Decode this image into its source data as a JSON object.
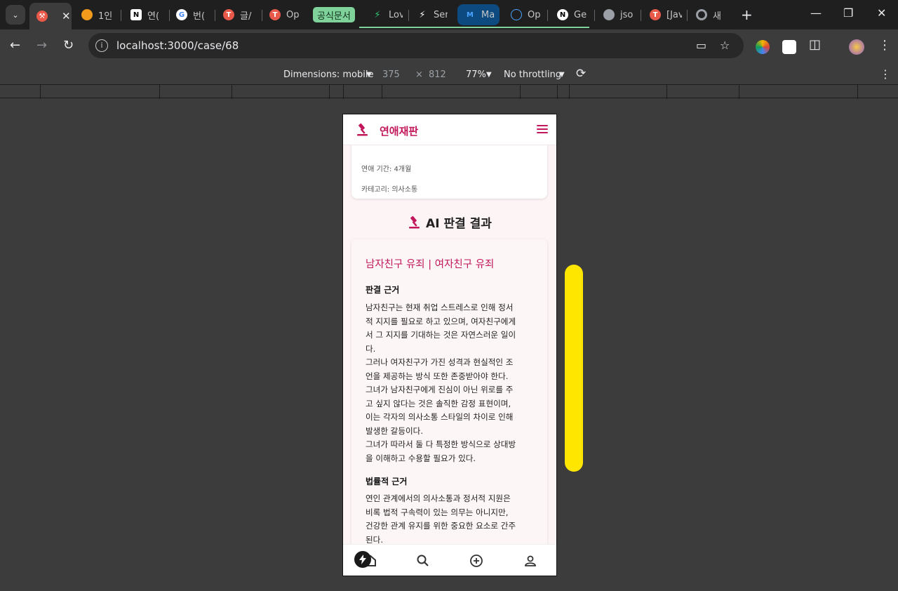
{
  "browser": {
    "tabs": [
      {
        "label": "",
        "icon": "gavel-icon",
        "color": "#e8594a"
      },
      {
        "label": "1인",
        "icon": "fire-icon",
        "color": "#f29a1c"
      },
      {
        "label": "연(",
        "icon": "notion-icon",
        "color": "#ffffff"
      },
      {
        "label": "번(",
        "icon": "google-icon",
        "color": "#4285f4"
      },
      {
        "label": "글/",
        "icon": "app-icon",
        "color": "#e8594a"
      },
      {
        "label": "Op",
        "icon": "app-icon",
        "color": "#e8594a"
      },
      {
        "label": "Lov",
        "icon": "bolt-icon",
        "color": "#2ecc71"
      },
      {
        "label": "Ser",
        "icon": "bolt-icon",
        "color": "#ffffff"
      },
      {
        "label": "Ma",
        "icon": "mj-icon",
        "color": "#4aa3ff"
      },
      {
        "label": "Op",
        "icon": "openai-icon",
        "color": "#4aa3ff"
      },
      {
        "label": "Ge",
        "icon": "n-icon",
        "color": "#ffffff"
      },
      {
        "label": "jso",
        "icon": "globe-icon",
        "color": "#9aa0a6"
      },
      {
        "label": "[Jav",
        "icon": "app-icon",
        "color": "#e8594a"
      },
      {
        "label": "새",
        "icon": "chrome-icon",
        "color": "#9aa0a6"
      }
    ],
    "special_tab": "공식문서",
    "url": "localhost:3000/case/68"
  },
  "devtools": {
    "dimensions": "Dimensions: mobile",
    "width": "375",
    "times": "×",
    "height": "812",
    "zoom": "77%",
    "throttling": "No throttling"
  },
  "app": {
    "name": "연애재판",
    "info": {
      "period": "연애 기간: 4개월",
      "category": "카테고리: 의사소통"
    },
    "section_title": "AI 판결 결과",
    "verdict": "남자친구 유죄 | 여자친구 유죄",
    "reasoning_heading": "판결 근거",
    "reasoning_lines": [
      "남자친구는 현재 취업 스트레스로 인해 정서",
      "적 지지를 필요로 하고 있으며, 여자친구에게",
      "서 그 지지를 기대하는 것은 자연스러운 일이",
      "다.",
      "그러나 여자친구가 가진 성격과 현실적인 조",
      "언을 제공하는 방식 또한 존중받아야 한다.",
      "그녀가 남자친구에게 진심이 아닌 위로를 주",
      "고 싶지 않다는 것은 솔직한 감정 표현이며,",
      "이는 각자의 의사소통 스타일의 차이로 인해",
      "발생한 갈등이다.",
      "그녀가 따라서 둘 다 특정한 방식으로 상대방",
      "을 이해하고 수용할 필요가 있다."
    ],
    "legal_heading": "법률적 근거",
    "legal_lines": [
      "연인 관계에서의 의사소통과 정서적 지원은",
      "비록 법적 구속력이 있는 의무는 아니지만,",
      "건강한 관계 유지를 위한 중요한 요소로 간주",
      "된다."
    ],
    "bottom_nav": [
      "home-icon",
      "search-icon",
      "add-circle-icon",
      "profile-icon"
    ],
    "accent_color": "#c2185b"
  }
}
